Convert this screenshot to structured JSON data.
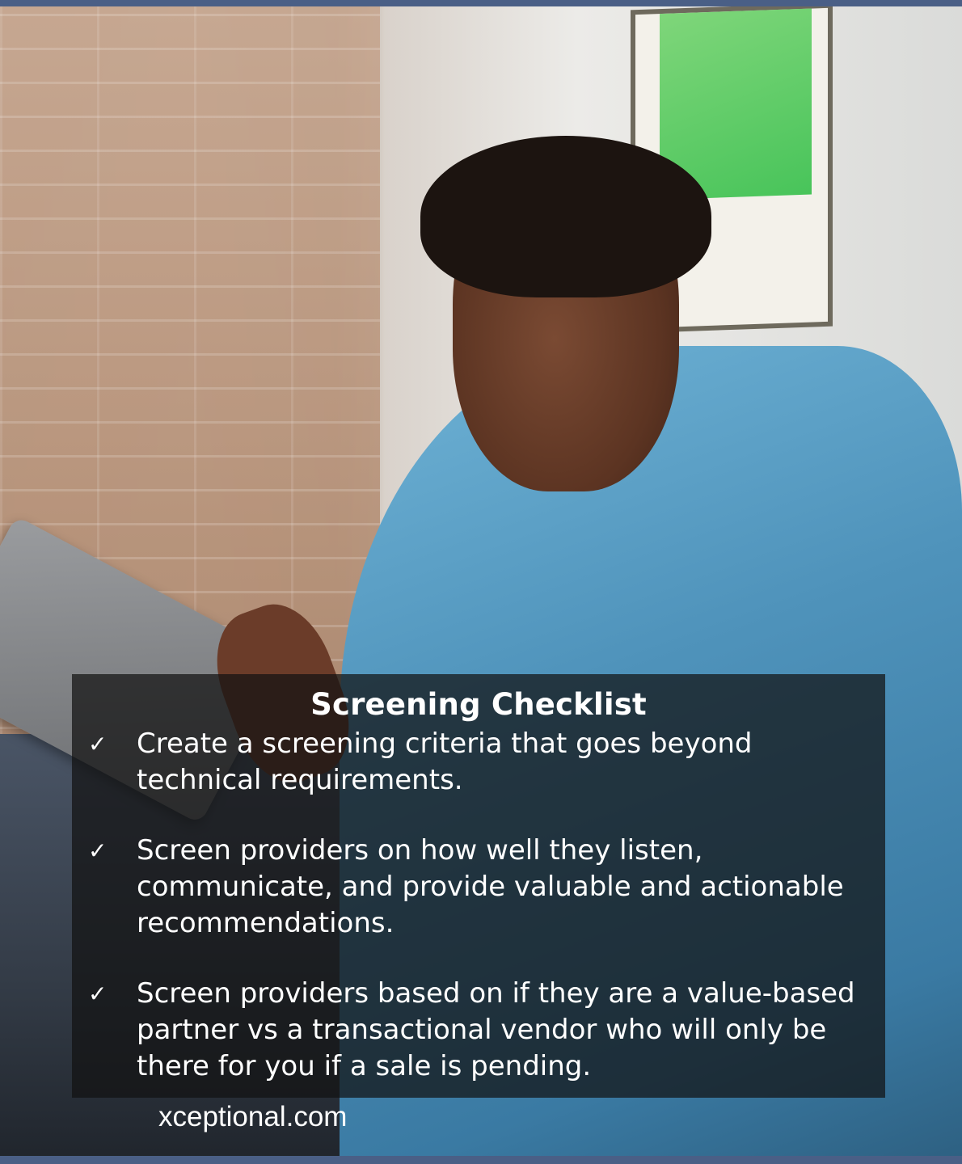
{
  "panel": {
    "title": "Screening Checklist",
    "items": [
      "Create a screening criteria that goes beyond technical requirements.",
      "Screen providers on how well they listen, communicate, and provide valuable and actionable recommendations.",
      "Screen providers based on if they are a value-based partner vs a transactional vendor who will only be there for you if a sale is pending."
    ],
    "check_icon": "check-mark-icon"
  },
  "watermark": "xceptional.com",
  "colors": {
    "frame_border": "#4a5f86",
    "panel_background": "rgba(18,18,18,0.72)",
    "text": "#ffffff"
  }
}
